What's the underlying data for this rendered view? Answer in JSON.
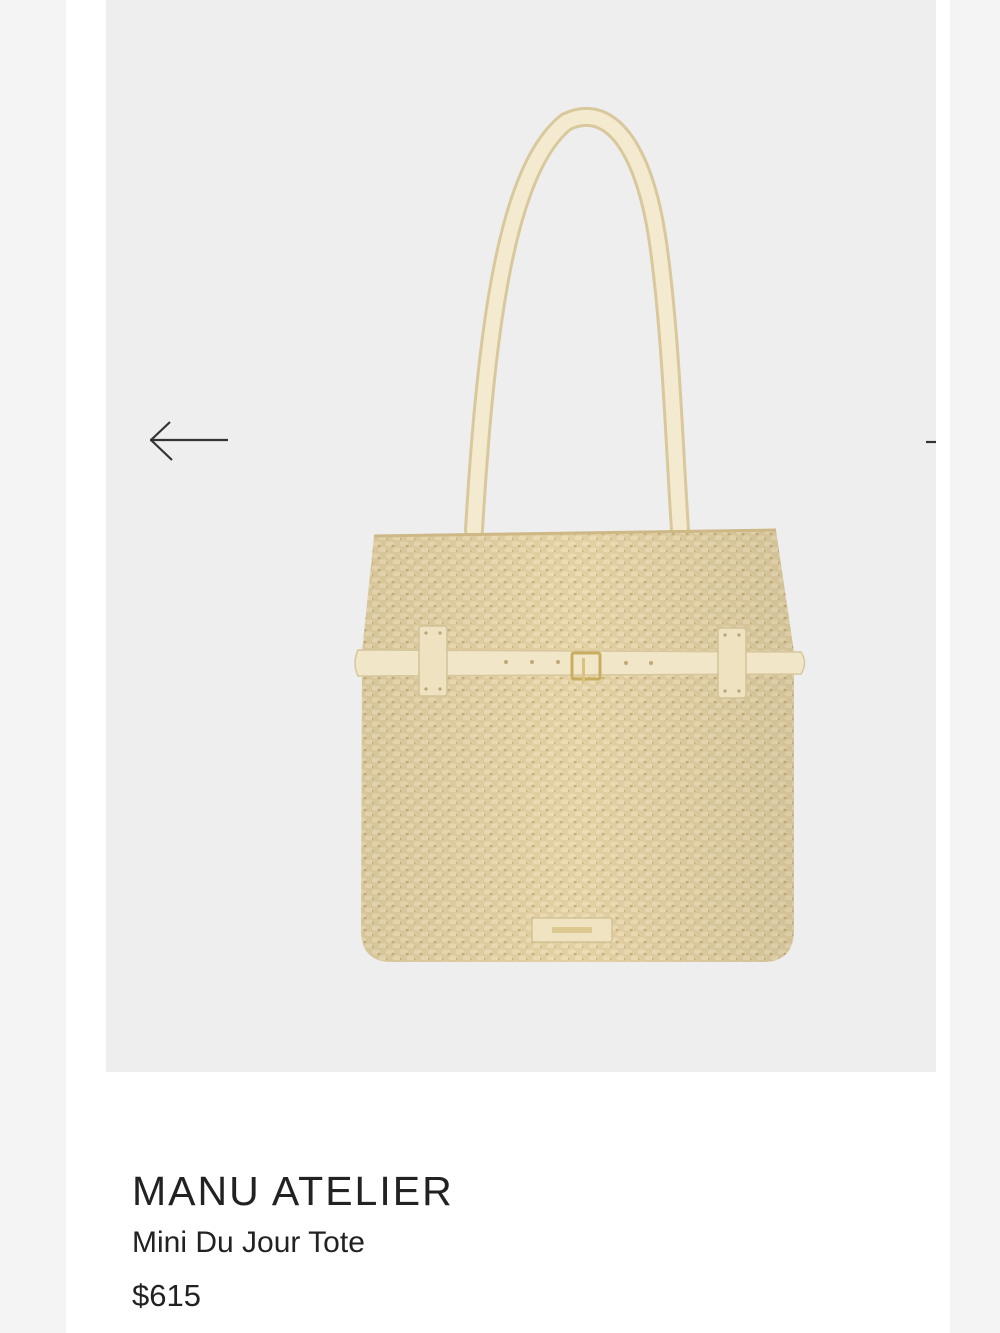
{
  "product": {
    "brand": "MANU ATELIER",
    "name": "Mini Du Jour Tote",
    "price": "$615",
    "image_alt": "Mini Du Jour Tote"
  },
  "icons": {
    "prev": "arrow-left-icon",
    "next": "arrow-right-icon"
  },
  "colors": {
    "image_background": "#efeeee",
    "raffia": "#e2cfa2",
    "leather": "#f1e6c8",
    "hardware": "#d9c37c",
    "text": "#222222"
  }
}
